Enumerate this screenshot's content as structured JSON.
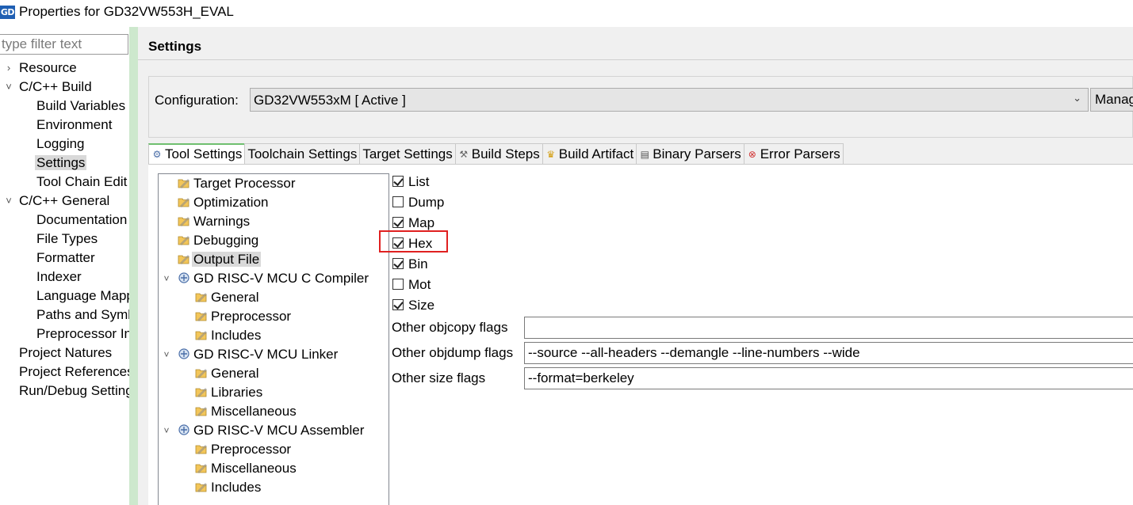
{
  "window": {
    "title": "Properties for GD32VW553H_EVAL",
    "logo_text": "GD"
  },
  "filter": {
    "placeholder": "type filter text",
    "value": ""
  },
  "nav": {
    "items": [
      {
        "label": "Resource",
        "indent": 0,
        "expander": "collapsed"
      },
      {
        "label": "C/C++ Build",
        "indent": 0,
        "expander": "expanded"
      },
      {
        "label": "Build Variables",
        "indent": 1
      },
      {
        "label": "Environment",
        "indent": 1
      },
      {
        "label": "Logging",
        "indent": 1
      },
      {
        "label": "Settings",
        "indent": 1,
        "selected": true
      },
      {
        "label": "Tool Chain Edit",
        "indent": 1
      },
      {
        "label": "C/C++ General",
        "indent": 0,
        "expander": "expanded"
      },
      {
        "label": "Documentation",
        "indent": 1
      },
      {
        "label": "File Types",
        "indent": 1
      },
      {
        "label": "Formatter",
        "indent": 1
      },
      {
        "label": "Indexer",
        "indent": 1
      },
      {
        "label": "Language Mapp",
        "indent": 1
      },
      {
        "label": "Paths and Symb",
        "indent": 1
      },
      {
        "label": "Preprocessor In",
        "indent": 1
      },
      {
        "label": "Project Natures",
        "indent": 0
      },
      {
        "label": "Project References",
        "indent": 0
      },
      {
        "label": "Run/Debug Settings",
        "indent": 0
      }
    ]
  },
  "settings": {
    "title": "Settings",
    "configuration_label": "Configuration:",
    "configuration_value": "GD32VW553xM  [ Active ]",
    "manage_label": "Manage Configurations..."
  },
  "tabs": [
    {
      "label": "Tool Settings",
      "icon": "tool-settings-icon",
      "active": true
    },
    {
      "label": "Toolchain Settings",
      "icon": ""
    },
    {
      "label": "Target Settings",
      "icon": ""
    },
    {
      "label": "Build Steps",
      "icon": "build-steps-icon"
    },
    {
      "label": "Build Artifact",
      "icon": "build-artifact-icon"
    },
    {
      "label": "Binary Parsers",
      "icon": "binary-parsers-icon"
    },
    {
      "label": "Error Parsers",
      "icon": "error-parsers-icon"
    }
  ],
  "tool_tree": [
    {
      "label": "Target Processor",
      "level": 0,
      "icon": "option-category-icon"
    },
    {
      "label": "Optimization",
      "level": 0,
      "icon": "option-category-icon"
    },
    {
      "label": "Warnings",
      "level": 0,
      "icon": "option-category-icon"
    },
    {
      "label": "Debugging",
      "level": 0,
      "icon": "option-category-icon"
    },
    {
      "label": "Output File",
      "level": 0,
      "icon": "option-category-icon",
      "selected": true
    },
    {
      "label": "GD RISC-V MCU C Compiler",
      "level": 0,
      "icon": "tool-icon",
      "expander": "expanded"
    },
    {
      "label": "General",
      "level": 1,
      "icon": "option-category-icon"
    },
    {
      "label": "Preprocessor",
      "level": 1,
      "icon": "option-category-icon"
    },
    {
      "label": "Includes",
      "level": 1,
      "icon": "option-category-icon"
    },
    {
      "label": "GD RISC-V MCU Linker",
      "level": 0,
      "icon": "tool-icon",
      "expander": "expanded"
    },
    {
      "label": "General",
      "level": 1,
      "icon": "option-category-icon"
    },
    {
      "label": "Libraries",
      "level": 1,
      "icon": "option-category-icon"
    },
    {
      "label": "Miscellaneous",
      "level": 1,
      "icon": "option-category-icon"
    },
    {
      "label": "GD RISC-V MCU Assembler",
      "level": 0,
      "icon": "tool-icon",
      "expander": "expanded"
    },
    {
      "label": "Preprocessor",
      "level": 1,
      "icon": "option-category-icon"
    },
    {
      "label": "Miscellaneous",
      "level": 1,
      "icon": "option-category-icon"
    },
    {
      "label": "Includes",
      "level": 1,
      "icon": "option-category-icon"
    }
  ],
  "output_options": [
    {
      "label": "List",
      "checked": true
    },
    {
      "label": "Dump",
      "checked": false
    },
    {
      "label": "Map",
      "checked": true
    },
    {
      "label": "Hex",
      "checked": true,
      "highlighted": true
    },
    {
      "label": "Bin",
      "checked": true
    },
    {
      "label": "Mot",
      "checked": false
    },
    {
      "label": "Size",
      "checked": true
    }
  ],
  "flags": [
    {
      "label": "Other objcopy flags",
      "value": ""
    },
    {
      "label": "Other objdump flags",
      "value": "--source --all-headers --demangle --line-numbers --wide"
    },
    {
      "label": "Other size flags",
      "value": "--format=berkeley"
    }
  ],
  "colors": {
    "highlight": "#e02020",
    "left_border": "#cde8cd",
    "active_tab_accent": "#6fbf6f",
    "selection": "#d9d9d9"
  }
}
